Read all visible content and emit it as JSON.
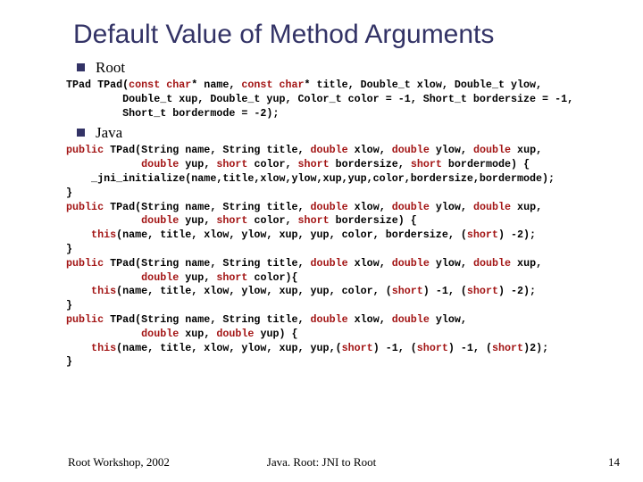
{
  "title": "Default Value of Method Arguments",
  "section1": {
    "label": "Root"
  },
  "root_code": {
    "l1a": "TPad TPad(",
    "l1b": "const char",
    "l1c": "* name, ",
    "l1d": "const char",
    "l1e": "* title, Double_t xlow, Double_t ylow,",
    "l2": "         Double_t xup, Double_t yup, Color_t color = -1, Short_t bordersize = -1,",
    "l3": "         Short_t bordermode = -2);"
  },
  "section2": {
    "label": "Java"
  },
  "java_code": {
    "l1a": "public",
    "l1b": " TPad(String name, String title, ",
    "l1c": "double",
    "l1d": " xlow, ",
    "l1e": "double",
    "l1f": " ylow, ",
    "l1g": "double",
    "l1h": " xup,",
    "l2a": "            ",
    "l2b": "double",
    "l2c": " yup, ",
    "l2d": "short",
    "l2e": " color, ",
    "l2f": "short",
    "l2g": " bordersize, ",
    "l2h": "short",
    "l2i": " bordermode) {",
    "l3": "    _jni_initialize(name,title,xlow,ylow,xup,yup,color,bordersize,bordermode);",
    "l4": "}",
    "l5a": "public",
    "l5b": " TPad(String name, String title, ",
    "l5c": "double",
    "l5d": " xlow, ",
    "l5e": "double",
    "l5f": " ylow, ",
    "l5g": "double",
    "l5h": " xup,",
    "l6a": "            ",
    "l6b": "double",
    "l6c": " yup, ",
    "l6d": "short",
    "l6e": " color, ",
    "l6f": "short",
    "l6g": " bordersize) {",
    "l7a": "    this",
    "l7b": "(name, title, xlow, ylow, xup, yup, color, bordersize, (",
    "l7c": "short",
    "l7d": ") -2);",
    "l8": "}",
    "l9a": "public",
    "l9b": " TPad(String name, String title, ",
    "l9c": "double",
    "l9d": " xlow, ",
    "l9e": "double",
    "l9f": " ylow, ",
    "l9g": "double",
    "l9h": " xup,",
    "l10a": "            ",
    "l10b": "double",
    "l10c": " yup, ",
    "l10d": "short",
    "l10e": " color){",
    "l11a": "    this",
    "l11b": "(name, title, xlow, ylow, xup, yup, color, (",
    "l11c": "short",
    "l11d": ") -1, (",
    "l11e": "short",
    "l11f": ") -2);",
    "l12": "}",
    "l13a": "public",
    "l13b": " TPad(String name, String title, ",
    "l13c": "double",
    "l13d": " xlow, ",
    "l13e": "double",
    "l13f": " ylow,",
    "l14a": "            ",
    "l14b": "double",
    "l14c": " xup, ",
    "l14d": "double",
    "l14e": " yup) {",
    "l15a": "    this",
    "l15b": "(name, title, xlow, ylow, xup, yup,(",
    "l15c": "short",
    "l15d": ") -1, (",
    "l15e": "short",
    "l15f": ") -1, (",
    "l15g": "short",
    "l15h": ")2);",
    "l16": "}"
  },
  "footer": {
    "left": "Root Workshop, 2002",
    "center": "Java. Root: JNI to Root",
    "right": "14"
  }
}
